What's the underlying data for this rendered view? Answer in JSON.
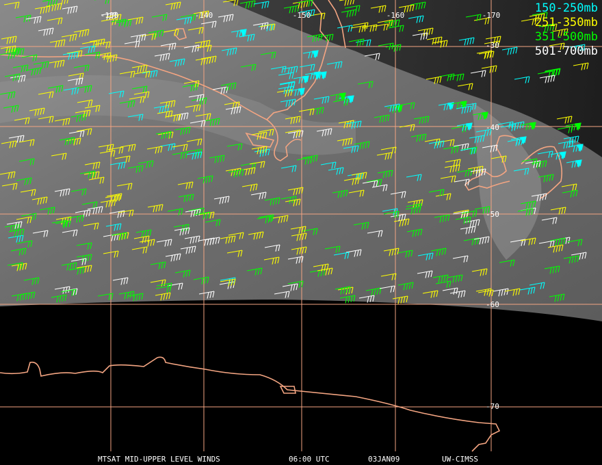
{
  "legend": [
    {
      "label": "150-250mb",
      "color": "#00ffff"
    },
    {
      "label": "251-350mb",
      "color": "#ffff00"
    },
    {
      "label": "351-500mb",
      "color": "#00ff00"
    },
    {
      "label": "501-700mb",
      "color": "#ffffff"
    }
  ],
  "longitude_labels": [
    "-130",
    "-140",
    "-150",
    "-160",
    "-170"
  ],
  "latitude_labels": [
    "-30",
    "-40",
    "-50",
    "-60",
    "-70"
  ],
  "footer": {
    "product": "MTSAT MID-UPPER LEVEL WINDS",
    "time": "06:00 UTC",
    "date": "03JAN09",
    "source": "UW-CIMSS"
  },
  "colors": {
    "grid": "#f4a582",
    "coastline": "#f4a582",
    "background_no_data": "#000000"
  }
}
